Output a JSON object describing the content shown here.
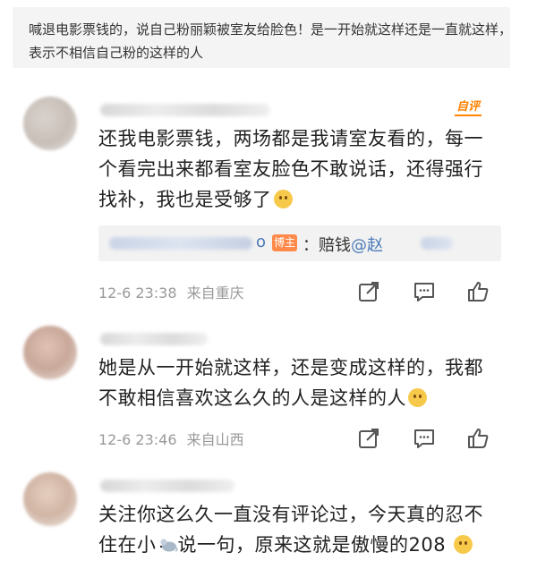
{
  "post": {
    "text": "喊退电影票钱的，说自己粉丽颖被室友给脸色！是一开始就这样还是一直就这样，表示不相信自己粉的这样的人"
  },
  "comments": [
    {
      "author_tag": "自评",
      "text": "还我电影票钱，两场都是我请室友看的，每一个看完出来都看室友脸色不敢说话，还得强行找补，我也是受够了",
      "reply": {
        "name_visible_suffix": "o",
        "badge": "博主",
        "text_prefix": "：赔钱",
        "mention": "@赵"
      },
      "time": "12-6 23:38",
      "location": "来自重庆"
    },
    {
      "text": "她是从一开始就这样，还是变成这样的，我都不敢相信喜欢这么久的人是这样的人",
      "time": "12-6 23:46",
      "location": "来自山西"
    },
    {
      "text_part1": "关注你这么久一直没有评论过，今天真的忍不住在小",
      "text_part2": "说一句，原来这就是傲慢的208"
    }
  ],
  "icons": [
    "share-icon",
    "comment-icon",
    "like-icon"
  ],
  "colors": {
    "accent": "#ff8200",
    "link": "#4a79b8",
    "meta": "#9a9a9a"
  }
}
